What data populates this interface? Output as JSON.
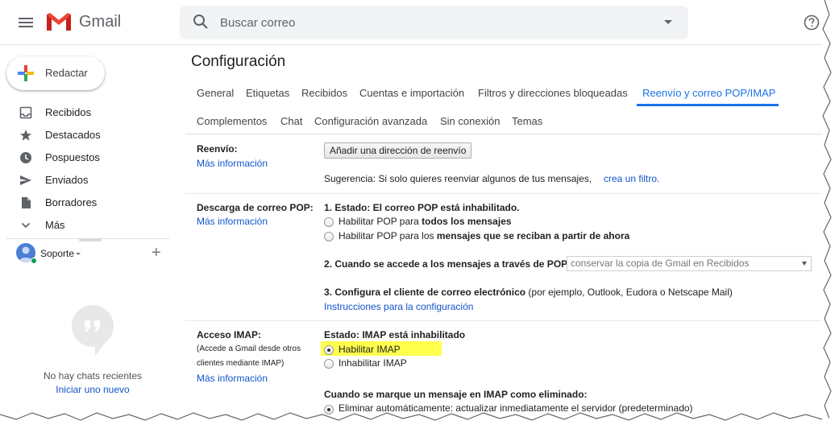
{
  "header": {
    "app_name": "Gmail",
    "search_placeholder": "Buscar correo",
    "icons": [
      "menu-icon",
      "gmail-logo-icon",
      "search-icon",
      "caret-down-icon",
      "help-icon"
    ]
  },
  "sidebar": {
    "compose_label": "Redactar",
    "items": [
      {
        "label": "Recibidos",
        "icon": "inbox-icon"
      },
      {
        "label": "Destacados",
        "icon": "star-icon"
      },
      {
        "label": "Pospuestos",
        "icon": "clock-icon"
      },
      {
        "label": "Enviados",
        "icon": "send-icon"
      },
      {
        "label": "Borradores",
        "icon": "draft-icon"
      },
      {
        "label": "Más",
        "icon": "chevron-down-icon"
      }
    ],
    "hangouts": {
      "user": "Soporte",
      "add": "+",
      "empty_text": "No hay chats recientes",
      "start_link": "Iniciar uno nuevo"
    }
  },
  "main": {
    "title": "Configuración",
    "tabs_row1": [
      "General",
      "Etiquetas",
      "Recibidos",
      "Cuentas e importación",
      "Filtros y direcciones bloqueadas",
      "Reenvío y correo POP/IMAP"
    ],
    "tabs_row2": [
      "Complementos",
      "Chat",
      "Configuración avanzada",
      "Sin conexión",
      "Temas"
    ],
    "active_tab": "Reenvío y correo POP/IMAP",
    "forwarding": {
      "label": "Reenvío:",
      "more": "Más información",
      "button": "Añadir una dirección de reenvío",
      "tip_prefix": "Sugerencia: Si solo quieres reenviar algunos de tus mensajes,",
      "tip_link": "crea un filtro."
    },
    "pop": {
      "label": "Descarga de correo POP:",
      "more": "Más información",
      "status": "1. Estado: El correo POP está inhabilitado.",
      "opt1_prefix": "Habilitar POP para",
      "opt1_bold": "todos los mensajes",
      "opt2_prefix": "Habilitar POP para los",
      "opt2_bold": "mensajes que se reciban a partir de ahora",
      "access_label": "2. Cuando se accede a los mensajes a través de POP",
      "access_value": "conservar la copia de Gmail en Recibidos",
      "configure_bold": "3. Configura el cliente de correo electrónico",
      "configure_rest": "(por ejemplo, Outlook, Eudora o Netscape Mail)",
      "instructions": "Instrucciones para la configuración"
    },
    "imap": {
      "label": "Acceso IMAP:",
      "note_line1": "(Accede a Gmail desde otros",
      "note_line2": "clientes mediante IMAP)",
      "more": "Más información",
      "status": "Estado: IMAP está inhabilitado",
      "enable": "Habilitar IMAP",
      "disable": "Inhabilitar IMAP",
      "selected": "Habilitar IMAP",
      "highlight_color": "#ffff4d",
      "deleted_heading": "Cuando se marque un mensaje en IMAP como eliminado:",
      "deleted_option": "Eliminar automáticamente: actualizar inmediatamente el servidor (predeterminado)"
    }
  },
  "colors": {
    "accent": "#1a73e8",
    "link": "#1155cc",
    "brand_red": "#ea4335"
  }
}
